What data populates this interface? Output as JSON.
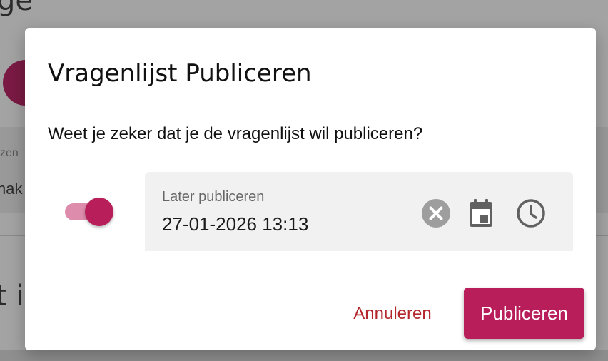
{
  "background": {
    "title_fragment": "ge",
    "label_fragment": "zen",
    "row_fragment": "nak",
    "heading_fragment": "t i"
  },
  "dialog": {
    "title": "Vragenlijst Publiceren",
    "question": "Weet je zeker dat je de vragenlijst wil publiceren?",
    "toggle": {
      "checked": true
    },
    "later_field": {
      "label": "Later publiceren",
      "value": "27-01-2026 13:13",
      "icons": [
        "clear-icon",
        "calendar-icon",
        "clock-icon"
      ]
    },
    "cancel_label": "Annuleren",
    "publish_label": "Publiceren"
  },
  "colors": {
    "accent": "#b81f5a",
    "accent_light": "#dd8cab",
    "cancel_text": "#b3262c",
    "icon_grey": "#616161"
  }
}
